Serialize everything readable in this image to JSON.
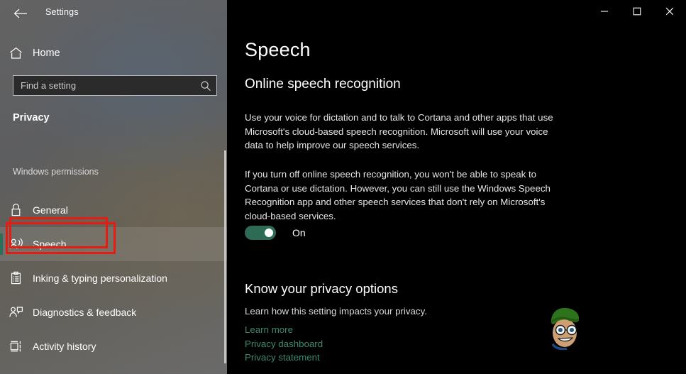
{
  "window": {
    "app_title": "Settings",
    "back_icon": "back-arrow-icon",
    "controls": {
      "minimize": "minimize-icon",
      "maximize": "maximize-icon",
      "close": "close-icon"
    }
  },
  "sidebar": {
    "home": {
      "label": "Home",
      "icon": "home-icon"
    },
    "search": {
      "placeholder": "Find a setting",
      "value": "",
      "icon": "search-icon"
    },
    "section_title": "Privacy",
    "group_label": "Windows permissions",
    "items": [
      {
        "label": "General",
        "icon": "lock-icon",
        "selected": false
      },
      {
        "label": "Speech",
        "icon": "person-speaking-icon",
        "selected": true
      },
      {
        "label": "Inking & typing personalization",
        "icon": "clipboard-icon",
        "selected": false
      },
      {
        "label": "Diagnostics & feedback",
        "icon": "person-feedback-icon",
        "selected": false
      },
      {
        "label": "Activity history",
        "icon": "timeline-icon",
        "selected": false
      }
    ]
  },
  "main": {
    "page_title": "Speech",
    "sub_heading": "Online speech recognition",
    "paragraph_1": "Use your voice for dictation and to talk to Cortana and other apps that use Microsoft's cloud-based speech recognition. Microsoft will use your voice data to help improve our speech services.",
    "paragraph_2": "If you turn off online speech recognition, you won't be able to speak to Cortana or use dictation. However, you can still use the Windows Speech Recognition app and other speech services that don't rely on Microsoft's cloud-based services.",
    "toggle": {
      "state": "On",
      "label": "On",
      "checked": true
    },
    "privacy": {
      "heading": "Know your privacy options",
      "description": "Learn how this setting impacts your privacy.",
      "links": [
        "Learn more",
        "Privacy dashboard",
        "Privacy statement"
      ]
    }
  },
  "annotations": {
    "color": "#e81b10",
    "boxes": [
      "speech-sidebar-item",
      "online-speech-toggle"
    ]
  },
  "colors": {
    "accent_teal": "#2d6f58",
    "link_green": "#3f8a6e",
    "content_bg": "#000000",
    "annotation_red": "#e81b10"
  }
}
